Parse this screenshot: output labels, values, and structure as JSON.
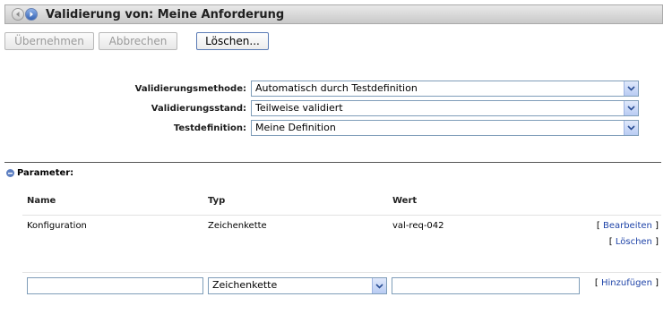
{
  "header": {
    "title": "Validierung von: Meine Anforderung"
  },
  "toolbar": {
    "apply_label": "Übernehmen",
    "cancel_label": "Abbrechen",
    "delete_label": "Löschen..."
  },
  "form": {
    "method_label": "Validierungsmethode:",
    "method_value": "Automatisch durch Testdefinition",
    "status_label": "Validierungsstand:",
    "status_value": "Teilweise validiert",
    "testdef_label": "Testdefinition:",
    "testdef_value": "Meine Definition"
  },
  "parameters": {
    "section_label": "Parameter:",
    "columns": [
      "Name",
      "Typ",
      "Wert"
    ],
    "rows": [
      {
        "name": "Konfiguration",
        "type": "Zeichenkette",
        "value": "val-req-042",
        "edit_label": "Bearbeiten",
        "delete_label": "Löschen"
      }
    ],
    "new_row": {
      "type_value": "Zeichenkette",
      "add_label": "Hinzufügen"
    }
  },
  "colors": {
    "accent": "#3462b3",
    "link": "#1f44a8",
    "disabled_text": "#9a9a9a"
  }
}
